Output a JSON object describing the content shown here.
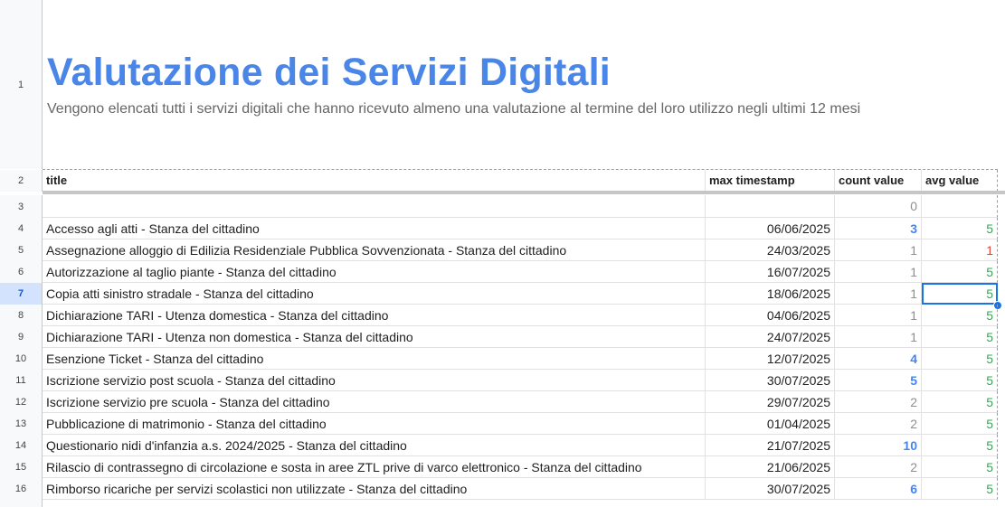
{
  "sheet": {
    "title": "Valutazione dei Servizi Digitali",
    "subtitle": "Vengono elencati tutti i servizi digitali che hanno ricevuto almeno una valutazione al termine del loro utilizzo negli ultimi 12 mesi",
    "row_numbers": [
      "1",
      "2",
      "3",
      "4",
      "5",
      "6",
      "7",
      "8",
      "9",
      "10",
      "11",
      "12",
      "13",
      "14",
      "15",
      "16"
    ],
    "headers": {
      "title": "title",
      "max_timestamp": "max timestamp",
      "count_value": "count value",
      "avg_value": "avg value"
    },
    "empty_row": {
      "count": "0"
    },
    "rows": [
      {
        "title": "Accesso agli atti - Stanza del cittadino",
        "ts": "06/06/2025",
        "count": "3",
        "avg": "5"
      },
      {
        "title": "Assegnazione alloggio di Edilizia Residenziale Pubblica Sovvenzionata - Stanza del cittadino",
        "ts": "24/03/2025",
        "count": "1",
        "avg": "1"
      },
      {
        "title": "Autorizzazione al taglio piante - Stanza del cittadino",
        "ts": "16/07/2025",
        "count": "1",
        "avg": "5"
      },
      {
        "title": "Copia atti sinistro stradale - Stanza del cittadino",
        "ts": "18/06/2025",
        "count": "1",
        "avg": "5"
      },
      {
        "title": "Dichiarazione TARI - Utenza domestica - Stanza del cittadino",
        "ts": "04/06/2025",
        "count": "1",
        "avg": "5"
      },
      {
        "title": "Dichiarazione TARI - Utenza non domestica - Stanza del cittadino",
        "ts": "24/07/2025",
        "count": "1",
        "avg": "5"
      },
      {
        "title": "Esenzione Ticket - Stanza del cittadino",
        "ts": "12/07/2025",
        "count": "4",
        "avg": "5"
      },
      {
        "title": "Iscrizione servizio post scuola - Stanza del cittadino",
        "ts": "30/07/2025",
        "count": "5",
        "avg": "5"
      },
      {
        "title": "Iscrizione servizio pre scuola - Stanza del cittadino",
        "ts": "29/07/2025",
        "count": "2",
        "avg": "5"
      },
      {
        "title": "Pubblicazione di matrimonio - Stanza del cittadino",
        "ts": "01/04/2025",
        "count": "2",
        "avg": "5"
      },
      {
        "title": "Questionario nidi d'infanzia a.s. 2024/2025 - Stanza del cittadino",
        "ts": "21/07/2025",
        "count": "10",
        "avg": "5"
      },
      {
        "title": "Rilascio di contrassegno di circolazione e sosta in aree ZTL prive di varco elettronico - Stanza del cittadino",
        "ts": "21/06/2025",
        "count": "2",
        "avg": "5"
      },
      {
        "title": "Rimborso ricariche per servizi scolastici non utilizzate - Stanza del cittadino",
        "ts": "30/07/2025",
        "count": "6",
        "avg": "5"
      }
    ],
    "colors": {
      "title": "#4a86e8",
      "count_high": "#4285f4",
      "count_low": "#8e8e8e",
      "avg_good": "#34a853",
      "avg_bad": "#ea4335",
      "selection": "#1a73e8"
    }
  }
}
